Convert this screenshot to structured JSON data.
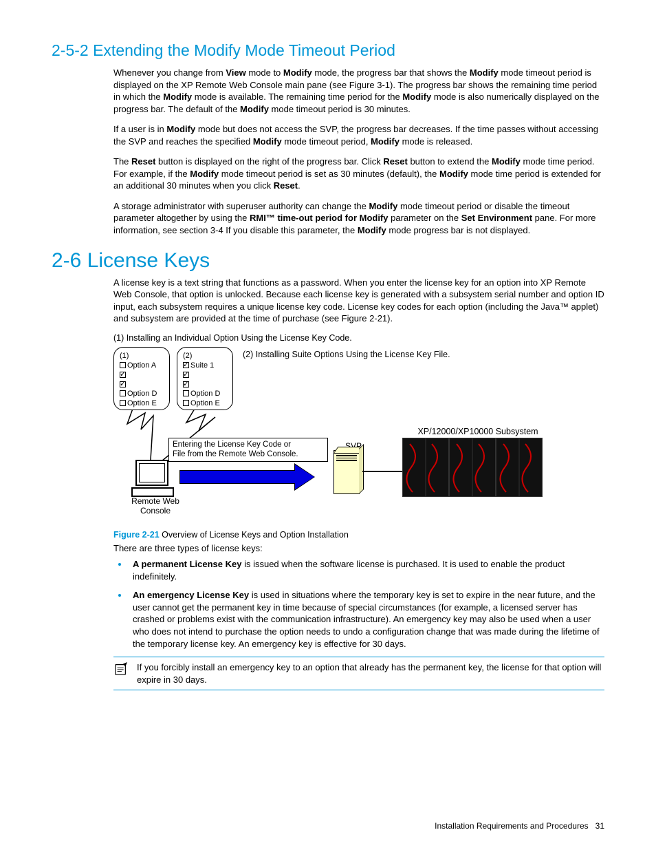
{
  "section_252": {
    "heading": "2-5-2 Extending the Modify Mode Timeout Period",
    "p1_a": "Whenever you change from ",
    "p1_view": "View",
    "p1_b": " mode to ",
    "p1_modify1": "Modify",
    "p1_c": " mode, the progress bar that shows the ",
    "p1_modify2": "Modify",
    "p1_d": " mode timeout period is displayed on the XP Remote Web Console main pane (see Figure 3-1). The progress bar shows the remaining time period in which the ",
    "p1_modify3": "Modify",
    "p1_e": " mode is available. The remaining time period for the ",
    "p1_modify4": "Modify",
    "p1_f": " mode is also numerically displayed on the progress bar. The default of the ",
    "p1_modify5": "Modify",
    "p1_g": " mode timeout period is 30 minutes.",
    "p2_a": "If a user is in ",
    "p2_modify1": "Modify",
    "p2_b": " mode but does not access the SVP, the progress bar decreases. If the time passes without accessing the SVP and reaches the specified ",
    "p2_modify2": "Modify",
    "p2_c": " mode timeout period, ",
    "p2_modify3": "Modify",
    "p2_d": " mode is released.",
    "p3_a": "The ",
    "p3_reset1": "Reset",
    "p3_b": " button is displayed on the right of the progress bar. Click ",
    "p3_reset2": "Reset",
    "p3_c": " button to extend the ",
    "p3_modify1": "Modify",
    "p3_d": " mode time period. For example, if the ",
    "p3_modify2": "Modify",
    "p3_e": " mode timeout period is set as 30 minutes (default), the ",
    "p3_modify3": "Modify",
    "p3_f": " mode time period is extended for an additional 30 minutes when you click ",
    "p3_reset3": "Reset",
    "p3_g": ".",
    "p4_a": "A storage administrator with superuser authority can change the ",
    "p4_modify1": "Modify",
    "p4_b": " mode timeout period or disable the timeout parameter altogether by using the ",
    "p4_rmi": "RMI™ time-out period for Modify",
    "p4_c": " parameter on the ",
    "p4_setenv": "Set Environment",
    "p4_d": " pane. For more information, see section 3-4 If you disable this parameter, the ",
    "p4_modify2": "Modify",
    "p4_e": " mode progress bar is not displayed."
  },
  "section_26": {
    "heading": "2-6 License Keys",
    "p1": "A license key is a text string that functions as a password. When you enter the license key for an option into XP Remote Web Console, that option is unlocked. Because each license key is generated with a subsystem serial number and option ID input, each subsystem requires a unique license key code. License key codes for each option (including the Java™ applet) and subsystem are provided at the time of purchase (see Figure 2-21)."
  },
  "diagram": {
    "caption1": "(1) Installing an Individual Option Using the License Key Code.",
    "caption2": "(2) Installing Suite Options Using the License Key File.",
    "bubble1": {
      "num": "(1)",
      "rows": [
        "Option A",
        "",
        "",
        "Option D",
        "Option E"
      ],
      "checks": [
        false,
        true,
        true,
        false,
        false
      ]
    },
    "bubble2": {
      "num": "(2)",
      "rows": [
        "Suite 1",
        "",
        "",
        "Option D",
        "Option E"
      ],
      "checks": [
        true,
        true,
        true,
        false,
        false
      ]
    },
    "entry_box_l1": "Entering the License Key Code or",
    "entry_box_l2": "File from the Remote Web Console.",
    "svp": "SVP",
    "subsystem": "XP/12000/XP10000 Subsystem",
    "rwc_l1": "Remote Web",
    "rwc_l2": "Console"
  },
  "figure": {
    "label": "Figure 2-21",
    "caption": " Overview of License Keys and Option Installation",
    "lead": "There are three types of license keys:"
  },
  "bullets": {
    "b1_bold": "A permanent License Key",
    "b1_rest": " is issued when the software license is purchased. It is used to enable the product indefinitely.",
    "b2_bold": "An emergency License Key",
    "b2_rest": " is used in situations where the temporary key is set to expire in the near future, and the user cannot get the permanent key in time because of special circumstances (for example, a licensed server has crashed or problems exist with the communication infrastructure). An emergency key may also be used when a user who does not intend to purchase the option needs to undo a configuration change that was made during the lifetime of the temporary license key. An emergency key is effective for 30 days."
  },
  "note": "If you forcibly install an emergency key to an option that already has the permanent key, the license for that option will expire in 30 days.",
  "footer": {
    "text": "Installation Requirements and Procedures",
    "page": "31"
  }
}
